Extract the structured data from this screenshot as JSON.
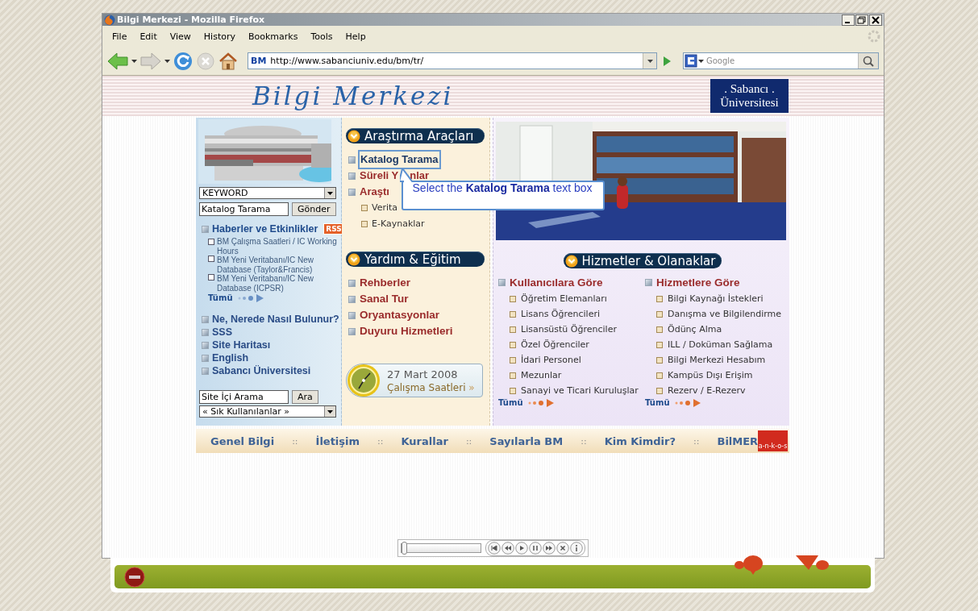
{
  "window": {
    "title": "Bilgi Merkezi - Mozilla Firefox"
  },
  "menu": [
    "File",
    "Edit",
    "View",
    "History",
    "Bookmarks",
    "Tools",
    "Help"
  ],
  "address": {
    "badge": "BM",
    "value": "http://www.sabanciuniv.edu/bm/tr/"
  },
  "search": {
    "placeholder": "Google"
  },
  "header": {
    "logo": "Bilgi Merkezi",
    "university_top": ". Sabancı .",
    "university_bottom": "Üniversitesi"
  },
  "left": {
    "search_type": "KEYWORD",
    "query": "Katalog Tarama",
    "submit": "Gönder",
    "news_heading": "Haberler ve Etkinlikler",
    "rss": "RSS",
    "news": [
      "BM Çalışma Saatleri / IC Working Hours",
      "BM Yeni Veritabanı/IC New Database (Taylor&Francis)",
      "BM Yeni Veritabanı/IC New Database (ICPSR)"
    ],
    "more": "Tümü",
    "links": [
      "Ne, Nerede Nasıl Bulunur?",
      "SSS",
      "Site Haritası",
      "English",
      "Sabancı Üniversitesi"
    ],
    "site_search": "Site İçi Arama",
    "site_search_button": "Ara",
    "favorites": "« Sık Kullanılanlar »"
  },
  "middle": {
    "research_title": "Araştırma Araçları",
    "research_items": [
      {
        "label": "Katalog Tarama",
        "highlighted": true
      },
      {
        "label": "Süreli Y",
        "label_after": "nlar",
        "highlighted": false
      },
      {
        "label": "Araştı",
        "highlighted": false
      }
    ],
    "research_subitems": [
      "Verita",
      "E-Kaynaklar"
    ],
    "help_title": "Yardım & Eğitim",
    "help_items": [
      "Rehberler",
      "Sanal Tur",
      "Oryantasyonlar",
      "Duyuru Hizmetleri"
    ],
    "hours": {
      "date": "27 Mart 2008",
      "link": "Çalışma Saatleri",
      "link_arrow": "»"
    }
  },
  "tooltip": "Select the **Katalog Tarama** text box",
  "right": {
    "title": "Hizmetler & Olanaklar",
    "groups": [
      {
        "heading": "Kullanıcılara Göre",
        "items": [
          "Öğretim Elemanları",
          "Lisans Öğrencileri",
          "Lisansüstü Öğrenciler",
          "Özel Öğrenciler",
          "İdari Personel",
          "Mezunlar",
          "Sanayi ve Ticari Kuruluşlar"
        ],
        "more": "Tümü"
      },
      {
        "heading": "Hizmetlere Göre",
        "items": [
          "Bilgi Kaynağı İstekleri",
          "Danışma ve Bilgilendirme",
          "Ödünç Alma",
          "ILL / Doküman Sağlama",
          "Bilgi Merkezi Hesabım",
          "Kampüs Dışı Erişim",
          "Rezerv / E-Rezerv"
        ],
        "more": "Tümü"
      }
    ]
  },
  "footer": {
    "links": [
      "Genel Bilgi",
      "İletişim",
      "Kurallar",
      "Sayılarla BM",
      "Kim Kimdir?",
      "BilMER"
    ],
    "separator": "::",
    "partner_logo": "a-n-k-o-s"
  },
  "player": {
    "level": 0.0
  }
}
